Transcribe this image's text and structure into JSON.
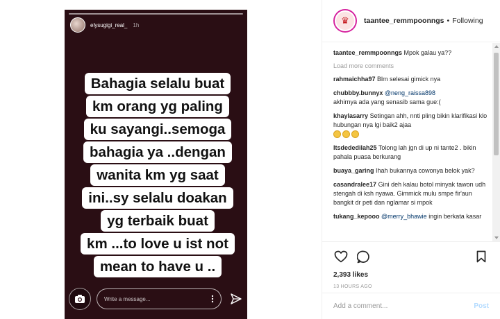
{
  "story": {
    "username": "elysugigi_real_",
    "time": "1h",
    "quote_lines": [
      "Bahagia selalu buat",
      "km orang yg paling",
      "ku sayangi..semoga",
      "bahagia ya ..dengan",
      "wanita km yg saat",
      "ini..sy selalu doakan",
      "yg terbaik buat",
      "km ...to love u ist not",
      "mean to have u .."
    ],
    "message_placeholder": "Write a message..."
  },
  "post": {
    "username": "taantee_remmpoonngs",
    "separator": "•",
    "follow_status": "Following",
    "caption_user": "taantee_remmpoonngs",
    "caption_text": "Mpok galau ya??",
    "load_more": "Load more comments",
    "comments": [
      {
        "user": "rahmaichha97",
        "text": "Blm selesai gimick nya"
      },
      {
        "user": "chubbby.bunnyx",
        "mention": "@neng_raissa898",
        "text": "akhirnya ada yang senasib sama gue:("
      },
      {
        "user": "khaylasarry",
        "text": "Setingan ahh, nnti pling bikin klarifikasi klo hubungan nya lgi baik2 ajaa",
        "emoji_count": 3
      },
      {
        "user": "ltsdededilah25",
        "text": "Tolong lah jgn di up ni tante2 . bikin pahala puasa berkurang"
      },
      {
        "user": "buaya_garing",
        "text": "Ihah bukannya cowonya belok yak?"
      },
      {
        "user": "casandralee17",
        "text": "Gini deh kalau botol minyak tawon udh stengah di ksh nyawa. Gimmick mulu smpe fir'aun bangkit dr peti dan nglamar si mpok"
      },
      {
        "user": "tukang_kepooo",
        "mention": "@merry_bhawie",
        "text": "ingin berkata kasar"
      }
    ],
    "likes": "2,393 likes",
    "time_ago": "13 HOURS AGO",
    "add_comment_placeholder": "Add a comment...",
    "post_label": "Post"
  },
  "icons": {
    "camera": "camera-icon",
    "more": "more-vertical-icon",
    "send": "send-icon",
    "like": "heart-icon",
    "comment": "comment-icon",
    "save": "bookmark-icon"
  },
  "colors": {
    "story_bg": "#2a0e14",
    "mention": "#003569",
    "muted": "#999999",
    "post_button": "#b3dbff"
  }
}
